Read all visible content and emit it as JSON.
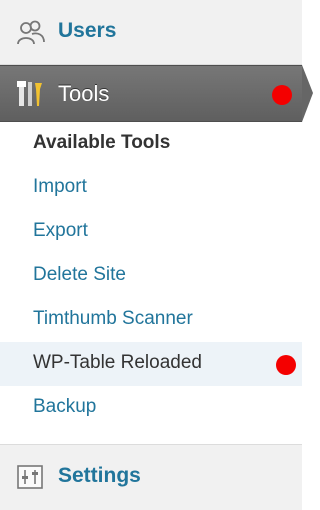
{
  "menu": {
    "users": {
      "label": "Users",
      "icon": "users-icon"
    },
    "tools": {
      "label": "Tools",
      "icon": "tools-icon",
      "badge_color": "#f40000"
    },
    "submenu": {
      "heading": "Available Tools",
      "items": [
        {
          "label": "Import"
        },
        {
          "label": "Export"
        },
        {
          "label": "Delete Site"
        },
        {
          "label": "Timthumb Scanner"
        },
        {
          "label": "WP-Table Reloaded",
          "hovered": true,
          "badge_color": "#f40000"
        },
        {
          "label": "Backup"
        }
      ]
    },
    "settings": {
      "label": "Settings",
      "icon": "settings-icon"
    }
  },
  "colors": {
    "link": "#21759b",
    "active_bg": "#6b6b6b",
    "sidebar_bg": "#f1f1f1",
    "hover_bg": "#edf3f8",
    "badge": "#f40000"
  }
}
